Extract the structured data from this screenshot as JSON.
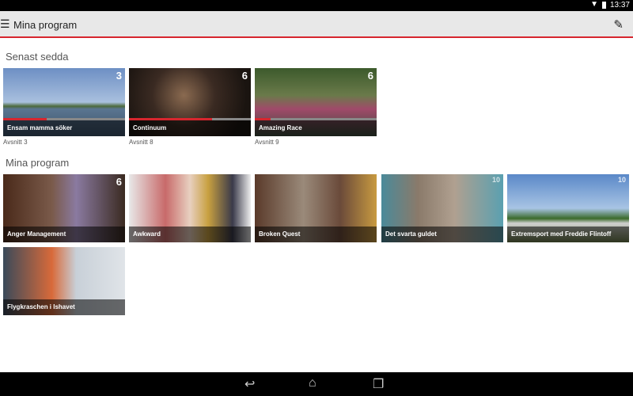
{
  "status": {
    "time": "13:37"
  },
  "appbar": {
    "title": "Mina program"
  },
  "recent": {
    "heading": "Senast sedda",
    "items": [
      {
        "title": "Ensam mamma söker",
        "episode": "Avsnitt 3",
        "progress": 0.36,
        "channel": "3"
      },
      {
        "title": "Continuum",
        "episode": "Avsnitt 8",
        "progress": 0.68,
        "channel": "6"
      },
      {
        "title": "Amazing Race",
        "episode": "Avsnitt 9",
        "progress": 0.13,
        "channel": "6"
      }
    ]
  },
  "mine": {
    "heading": "Mina program",
    "items": [
      {
        "title": "Anger Management",
        "channel": "6"
      },
      {
        "title": "Awkward"
      },
      {
        "title": "Broken Quest"
      },
      {
        "title": "Det svarta guldet",
        "channel": "10"
      },
      {
        "title": "Extremsport med Freddie Flintoff",
        "channel": "10"
      },
      {
        "title": "Flygkraschen i Ishavet"
      }
    ]
  }
}
